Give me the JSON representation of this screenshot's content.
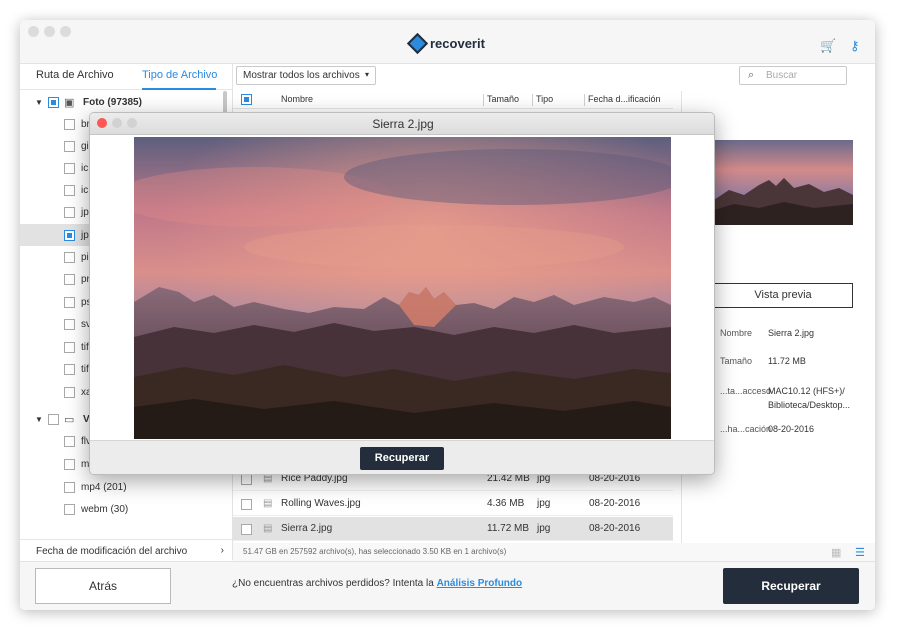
{
  "app": {
    "logo_text": "recoverit",
    "accent": "#2a8be0",
    "dark": "#242d3c"
  },
  "toolbar_icons": {
    "cart": "cart-icon",
    "key": "key-icon"
  },
  "tabs": [
    {
      "label": "Ruta de Archivo"
    },
    {
      "label": "Tipo de Archivo"
    }
  ],
  "filter": {
    "label": "Mostrar todos los archivos"
  },
  "search": {
    "placeholder": "Buscar"
  },
  "sidebar": {
    "groups": [
      {
        "label": "Foto (97385)",
        "checked": true
      },
      {
        "label": "V",
        "checked": false
      }
    ],
    "items": [
      {
        "label": "br",
        "checked": false
      },
      {
        "label": "gi",
        "checked": false
      },
      {
        "label": "ic",
        "checked": false
      },
      {
        "label": "ic",
        "checked": false
      },
      {
        "label": "jp",
        "checked": false
      },
      {
        "label": "jp",
        "checked": true
      },
      {
        "label": "pi",
        "checked": false
      },
      {
        "label": "pr",
        "checked": false
      },
      {
        "label": "ps",
        "checked": false
      },
      {
        "label": "sv",
        "checked": false
      },
      {
        "label": "tif",
        "checked": false
      },
      {
        "label": "tif",
        "checked": false
      },
      {
        "label": "xa",
        "checked": false
      }
    ],
    "video_items": [
      {
        "label": "flv",
        "checked": false
      },
      {
        "label": "m",
        "checked": false
      },
      {
        "label": "mp4 (201)",
        "checked": false
      },
      {
        "label": "webm (30)",
        "checked": false
      }
    ],
    "sort_label": "Fecha de modificación del archivo"
  },
  "columns": {
    "name": "Nombre",
    "size": "Tamaño",
    "type": "Tipo",
    "date": "Fecha d...ificación"
  },
  "files": [
    {
      "name": "Rice Paddy.jpg",
      "size": "21.42 MB",
      "type": "jpg",
      "date": "08-20-2016"
    },
    {
      "name": "Rolling Waves.jpg",
      "size": "4.36 MB",
      "type": "jpg",
      "date": "08-20-2016"
    },
    {
      "name": "Sierra 2.jpg",
      "size": "11.72 MB",
      "type": "jpg",
      "date": "08-20-2016"
    }
  ],
  "status": "51.47 GB en 257592 archivo(s), has seleccionado 3.50 KB en 1 archivo(s)",
  "preview_panel": {
    "button": "Vista previa",
    "props": [
      {
        "label": "Nombre",
        "value": "Sierra 2.jpg"
      },
      {
        "label": "Tamaño",
        "value": "11.72 MB"
      },
      {
        "label": "...ta...acceso",
        "value": "MAC10.12 (HFS+)/ Biblioteca/Desktop..."
      },
      {
        "label": "...ha...cación",
        "value": "08-20-2016"
      }
    ]
  },
  "modal": {
    "title": "Sierra 2.jpg",
    "button": "Recuperar"
  },
  "footer": {
    "back": "Atrás",
    "hint_text": "¿No encuentras archivos perdidos? Intenta la ",
    "hint_link": "Análisis Profundo",
    "recover": "Recuperar"
  }
}
